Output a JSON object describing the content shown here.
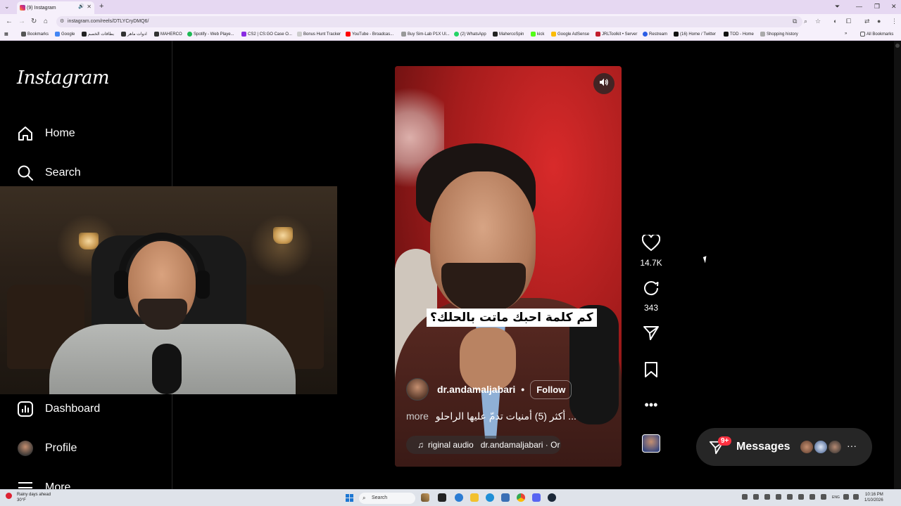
{
  "browser": {
    "tab_title": "(9) Instagram",
    "new_tab": "+",
    "url": "instagram.com/reels/DTLYCryDMQ6/",
    "window_controls": [
      "⌄",
      "—",
      "❐",
      "✕"
    ],
    "bookmarks": [
      {
        "label": "Bookmarks",
        "color": "#555555"
      },
      {
        "label": "Google",
        "color": "#4285f4"
      },
      {
        "label": "بطاقات الخصم",
        "color": "#222222"
      },
      {
        "label": "ادوات ماهر",
        "color": "#333333"
      },
      {
        "label": "MAHERCO",
        "color": "#333333"
      },
      {
        "label": "Spotify - Web Playe...",
        "color": "#1db954"
      },
      {
        "label": "CS2 | CS:GO Case O...",
        "color": "#8a2be2"
      },
      {
        "label": "Bonus Hunt Tracker",
        "color": "#cccccc"
      },
      {
        "label": "YouTube - Broadcas...",
        "color": "#ff0000"
      },
      {
        "label": "Buy Sim-Lab P1X Ul...",
        "color": "#999999"
      },
      {
        "label": "(2) WhatsApp",
        "color": "#25d366"
      },
      {
        "label": "MahercoSpin",
        "color": "#222222"
      },
      {
        "label": "kick",
        "color": "#53fc18"
      },
      {
        "label": "Google AdSense",
        "color": "#fbbc05"
      },
      {
        "label": "JRLToolkit • Server",
        "color": "#c21d2d"
      },
      {
        "label": "Restream",
        "color": "#2b5ce6"
      },
      {
        "label": "(16) Home / Twitter",
        "color": "#111111"
      },
      {
        "label": "TOD - Home",
        "color": "#111111"
      },
      {
        "label": "Shopping history",
        "color": "#aaaaaa"
      }
    ],
    "all_bookmarks": "All Bookmarks"
  },
  "sidebar": {
    "logo": "Instagram",
    "items": [
      {
        "label": "Home",
        "icon": "home-icon"
      },
      {
        "label": "Search",
        "icon": "search-icon"
      },
      {
        "label": "Dashboard",
        "icon": "dashboard-icon"
      },
      {
        "label": "Profile",
        "icon": "avatar"
      },
      {
        "label": "More",
        "icon": "menu-icon"
      }
    ]
  },
  "reel": {
    "caption_overlay": "كم كلمة احبك ماتت بالحلك؟",
    "author": "dr.andamaljabari",
    "separator": "•",
    "follow_label": "Follow",
    "description": "أكثر (5) أمنيات تدمّ عليها الراحلو ...",
    "more_label": "more",
    "audio": "riginal audio",
    "audio_author": "dr.andamaljabari · Or"
  },
  "actions": {
    "likes": "14.7K",
    "comments": "343"
  },
  "messages": {
    "label": "Messages",
    "badge": "9+",
    "more": "···"
  },
  "taskbar": {
    "weather_title": "Rainy days ahead",
    "weather_temp": "30°F",
    "search_placeholder": "Search",
    "lang": "ENG",
    "time": "10:16 PM",
    "date": "1/10/2026"
  },
  "colors": {
    "accent": "#ff3040",
    "page_bg": "#000000",
    "browser_tab_bg": "#e6d8f2"
  }
}
